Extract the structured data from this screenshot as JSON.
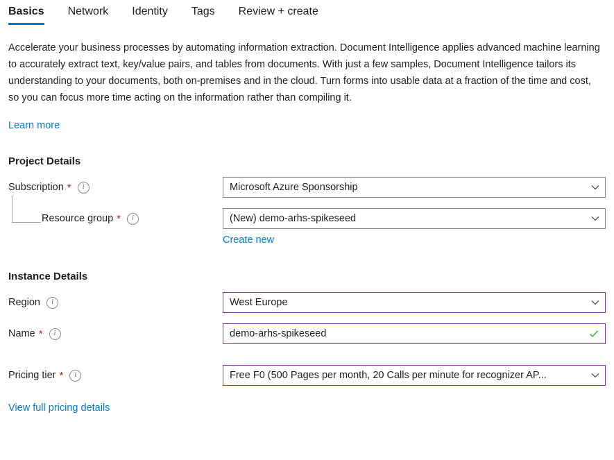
{
  "tabs": [
    {
      "label": "Basics",
      "active": true
    },
    {
      "label": "Network",
      "active": false
    },
    {
      "label": "Identity",
      "active": false
    },
    {
      "label": "Tags",
      "active": false
    },
    {
      "label": "Review + create",
      "active": false
    }
  ],
  "description": "Accelerate your business processes by automating information extraction. Document Intelligence applies advanced machine learning to accurately extract text, key/value pairs, and tables from documents. With just a few samples, Document Intelligence tailors its understanding to your documents, both on-premises and in the cloud. Turn forms into usable data at a fraction of the time and cost, so you can focus more time acting on the information rather than compiling it.",
  "links": {
    "learn_more": "Learn more",
    "create_new": "Create new",
    "view_pricing": "View full pricing details"
  },
  "project_details": {
    "heading": "Project Details",
    "subscription": {
      "label": "Subscription",
      "required": "*",
      "info_icon": "info-icon",
      "value": "Microsoft Azure Sponsorship",
      "chevron_icon": "chevron-down-icon"
    },
    "resource_group": {
      "label": "Resource group",
      "required": "*",
      "info_icon": "info-icon",
      "value": "(New) demo-arhs-spikeseed",
      "chevron_icon": "chevron-down-icon"
    }
  },
  "instance_details": {
    "heading": "Instance Details",
    "region": {
      "label": "Region",
      "info_icon": "info-icon",
      "value": "West Europe",
      "chevron_icon": "chevron-down-icon"
    },
    "name": {
      "label": "Name",
      "required": "*",
      "info_icon": "info-icon",
      "value": "demo-arhs-spikeseed",
      "validation_icon": "checkmark-icon"
    },
    "pricing_tier": {
      "label": "Pricing tier",
      "required": "*",
      "info_icon": "info-icon",
      "value": "Free F0 (500 Pages per month, 20 Calls per minute for recognizer AP...",
      "chevron_icon": "chevron-down-icon"
    }
  },
  "colors": {
    "accent": "#0078d4",
    "required_asterisk": "#a4262c",
    "field_border": "#8a8886",
    "field_border_focus": "#8f2fae",
    "validation_success": "#5ab85a",
    "text": "#201f1e"
  }
}
